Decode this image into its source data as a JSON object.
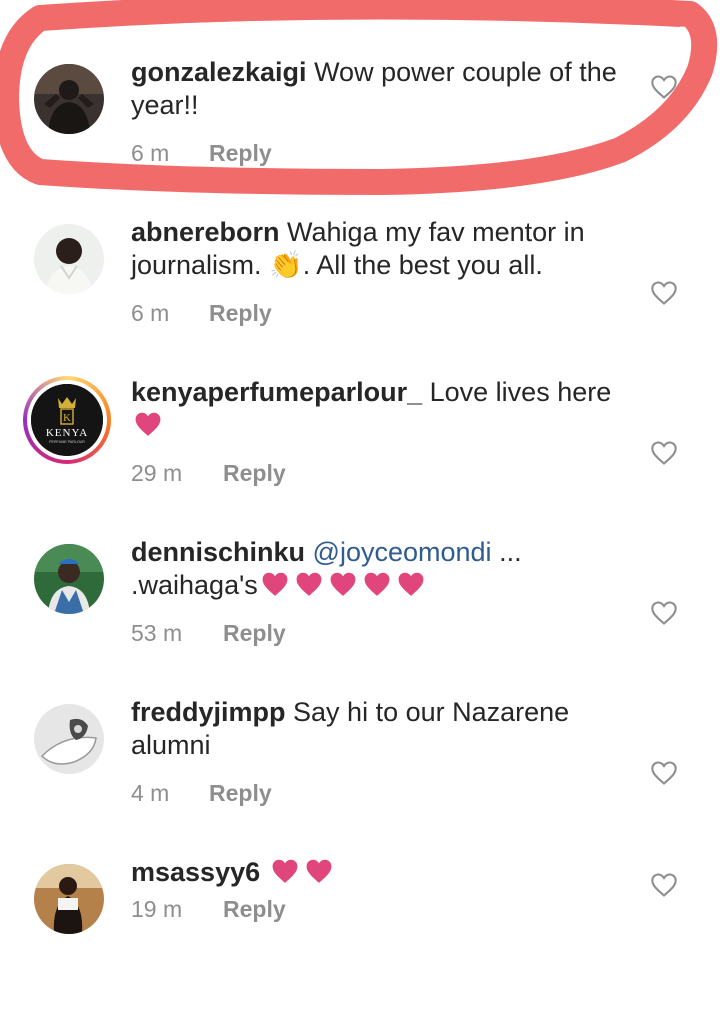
{
  "comments": [
    {
      "username": "gonzalezkaigi",
      "text": "Wow power couple of the year!!",
      "time": "6 m",
      "reply": "Reply"
    },
    {
      "username": "abnereborn",
      "text_before": "Wahiga my fav mentor in journalism.",
      "emoji": "👏",
      "text_after": ". All the best you all.",
      "time": "6 m",
      "reply": "Reply"
    },
    {
      "username": "kenyaperfumeparlour_",
      "text": "Love lives here",
      "time": "29 m",
      "reply": "Reply",
      "avatar_logo_text": "KENYA",
      "avatar_logo_sub": "PERFUME PARLOUR",
      "avatar_logo_mark": "K"
    },
    {
      "username": "dennischinku",
      "mention": "@joyceomondi",
      "text": "... .waihaga's",
      "time": "53 m",
      "reply": "Reply"
    },
    {
      "username": "freddyjimpp",
      "text": "Say hi to our Nazarene alumni",
      "time": "4 m",
      "reply": "Reply"
    },
    {
      "username": "msassyy6",
      "time": "19 m",
      "reply": "Reply"
    }
  ],
  "colors": {
    "username": "#262626",
    "meta": "#8e8e8e",
    "mention": "#2f5b92",
    "heart_emoji": "#e0457b",
    "highlight": "#f26b6b"
  },
  "icons": {
    "like": "heart-outline-icon",
    "emoji_heart": "heart-emoji-icon",
    "clap": "clapping-hands-emoji"
  }
}
